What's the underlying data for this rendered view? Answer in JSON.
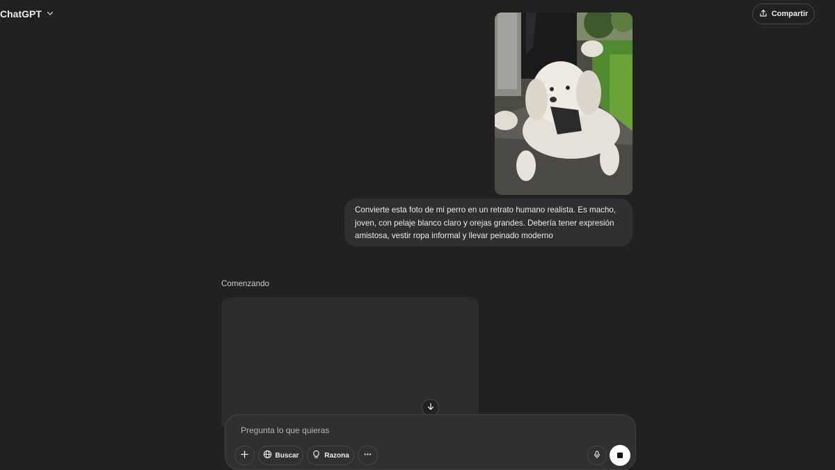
{
  "header": {
    "model_name": "ChatGPT",
    "share_label": "Compartir"
  },
  "conversation": {
    "user_image_icon": "photo-of-white-dog",
    "user_message": "Convierte esta foto de mi perro en un retrato humano realista. Es macho, joven, con pelaje blanco claro y orejas grandes. Debería tener expresión amistosa, vestir ropa informal y llevar peinado moderno",
    "assistant_status": "Comenzando"
  },
  "composer": {
    "placeholder": "Pregunta lo que quieras",
    "buttons": {
      "search_label": "Buscar",
      "reason_label": "Razona"
    }
  },
  "colors": {
    "background": "#212121",
    "bubble": "#303030",
    "text": "#ececec",
    "stop_button": "#ffffff"
  }
}
